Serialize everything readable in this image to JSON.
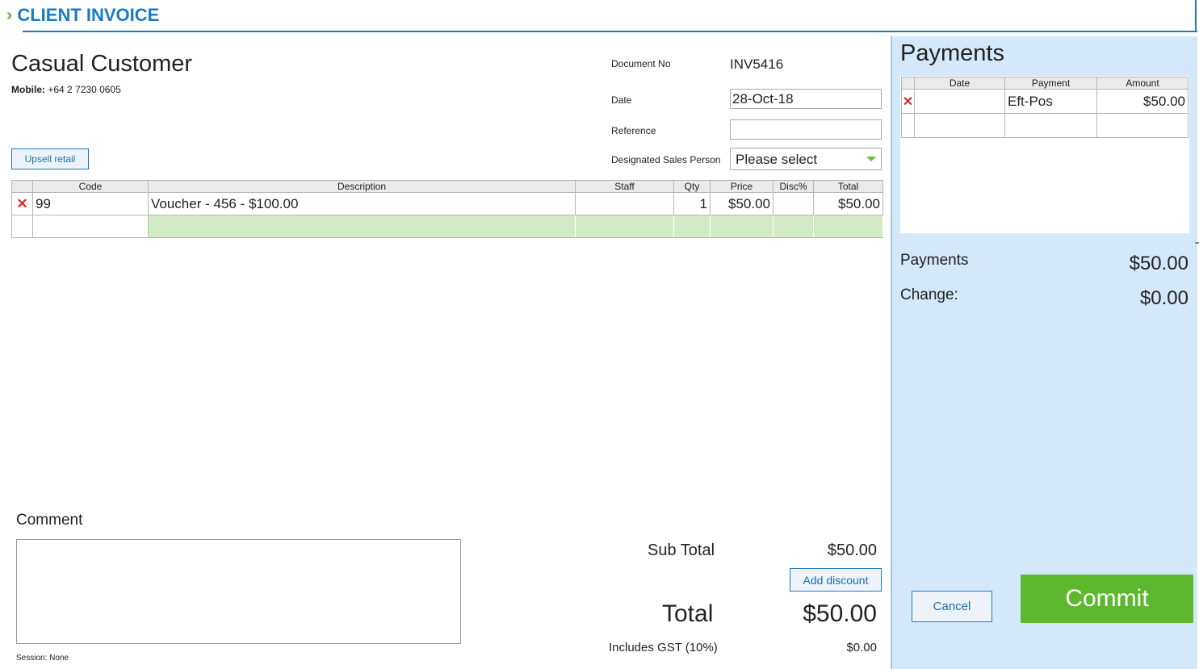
{
  "header": {
    "title": "CLIENT INVOICE",
    "chevron_icon": "double-chevron-right"
  },
  "customer": {
    "name": "Casual Customer",
    "mobile_label": "Mobile:",
    "mobile": "+64 2 7230 0605"
  },
  "upsell_label": "Upsell retail",
  "document": {
    "doc_no_label": "Document No",
    "doc_no": "INV5416",
    "date_label": "Date",
    "date": "28-Oct-18",
    "reference_label": "Reference",
    "reference": "",
    "sales_person_label": "Designated Sales Person",
    "sales_person": "Please select"
  },
  "invoice": {
    "columns": [
      "Code",
      "Description",
      "Staff",
      "Qty",
      "Price",
      "Disc%",
      "Total"
    ],
    "rows": [
      {
        "code": "99",
        "description": "Voucher - 456 - $100.00",
        "staff": "",
        "qty": "1",
        "price": "$50.00",
        "disc": "",
        "total": "$50.00"
      }
    ]
  },
  "comment": {
    "label": "Comment",
    "value": ""
  },
  "session": "Session: None",
  "totals": {
    "sub_total_label": "Sub Total",
    "sub_total": "$50.00",
    "add_discount_label": "Add discount",
    "total_label": "Total",
    "total": "$50.00",
    "gst_label": "Includes GST (10%)",
    "gst": "$0.00"
  },
  "payments": {
    "title": "Payments",
    "columns": [
      "Date",
      "Payment",
      "Amount"
    ],
    "rows": [
      {
        "date": "",
        "payment": "Eft-Pos",
        "amount": "$50.00"
      }
    ],
    "payments_label": "Payments",
    "payments_value": "$50.00",
    "change_label": "Change:",
    "change_value": "$0.00"
  },
  "actions": {
    "cancel_label": "Cancel",
    "commit_label": "Commit"
  },
  "colors": {
    "accent_blue": "#1a7bc4",
    "commit_green": "#5eb82e",
    "panel_bg": "#d5e8f9",
    "delete_red": "#d52b2b"
  }
}
